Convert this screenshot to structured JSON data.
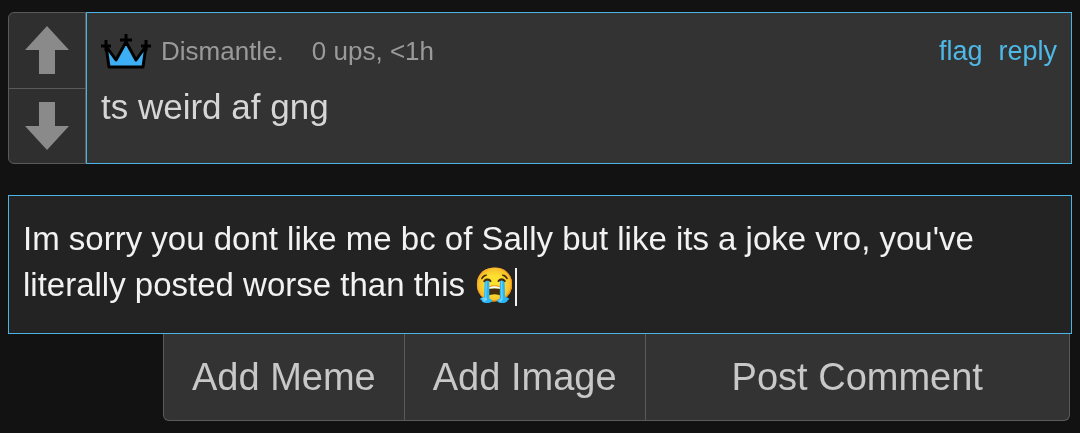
{
  "comment": {
    "username": "Dismantle.",
    "meta": "0 ups, <1h",
    "actions": [
      "flag",
      "reply"
    ],
    "body": "ts weird af gng"
  },
  "compose": {
    "value": "Im sorry you dont like me bc of Sally but like its a joke vro, you've literally posted worse than this 😭"
  },
  "buttons": [
    "Add Meme",
    "Add Image",
    "Post Comment"
  ]
}
